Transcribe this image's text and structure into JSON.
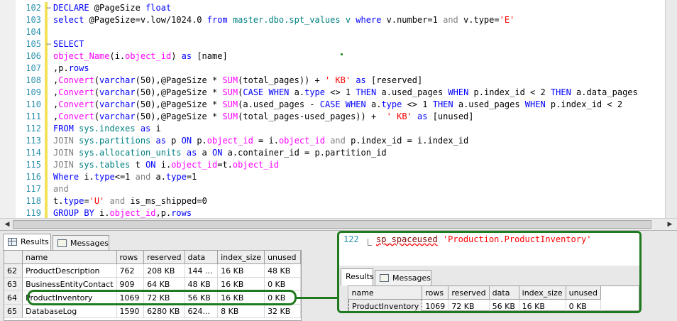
{
  "editor": {
    "lines": [
      {
        "num": "102",
        "tokens": [
          {
            "t": "DECLARE",
            "c": "kw"
          },
          {
            "t": " @PageSize ",
            "c": ""
          },
          {
            "t": "float",
            "c": "kw"
          }
        ]
      },
      {
        "num": "103",
        "tokens": [
          {
            "t": "select",
            "c": "kw"
          },
          {
            "t": " @PageSize=v.low/1024.0 ",
            "c": ""
          },
          {
            "t": "from",
            "c": "kw"
          },
          {
            "t": " master.dbo.spt_values v ",
            "c": "cm"
          },
          {
            "t": "where",
            "c": "kw"
          },
          {
            "t": " v.number=1 ",
            "c": ""
          },
          {
            "t": "and",
            "c": "op"
          },
          {
            "t": " v.type=",
            "c": ""
          },
          {
            "t": "'E'",
            "c": "st"
          }
        ]
      },
      {
        "num": "104",
        "tokens": []
      },
      {
        "num": "105",
        "tokens": [
          {
            "t": "SELECT",
            "c": "kw"
          }
        ]
      },
      {
        "num": "106",
        "tokens": [
          {
            "t": "object_Name",
            "c": "fn"
          },
          {
            "t": "(i.",
            "c": ""
          },
          {
            "t": "object_id",
            "c": "fn"
          },
          {
            "t": ") ",
            "c": ""
          },
          {
            "t": "as",
            "c": "kw"
          },
          {
            "t": " [name]",
            "c": ""
          }
        ]
      },
      {
        "num": "107",
        "tokens": [
          {
            "t": ",p.",
            "c": ""
          },
          {
            "t": "rows",
            "c": "kw"
          }
        ]
      },
      {
        "num": "108",
        "tokens": [
          {
            "t": ",",
            "c": ""
          },
          {
            "t": "Convert",
            "c": "fn"
          },
          {
            "t": "(",
            "c": ""
          },
          {
            "t": "varchar",
            "c": "kw"
          },
          {
            "t": "(50),@PageSize * ",
            "c": ""
          },
          {
            "t": "SUM",
            "c": "fn"
          },
          {
            "t": "(total_pages)) + ",
            "c": ""
          },
          {
            "t": "' KB'",
            "c": "st"
          },
          {
            "t": " ",
            "c": ""
          },
          {
            "t": "as",
            "c": "kw"
          },
          {
            "t": " [reserved]",
            "c": ""
          }
        ]
      },
      {
        "num": "109",
        "tokens": [
          {
            "t": ",",
            "c": ""
          },
          {
            "t": "Convert",
            "c": "fn"
          },
          {
            "t": "(",
            "c": ""
          },
          {
            "t": "varchar",
            "c": "kw"
          },
          {
            "t": "(50),@PageSize * ",
            "c": ""
          },
          {
            "t": "SUM",
            "c": "fn"
          },
          {
            "t": "(",
            "c": ""
          },
          {
            "t": "CASE WHEN",
            "c": "kw"
          },
          {
            "t": " a.",
            "c": ""
          },
          {
            "t": "type",
            "c": "kw"
          },
          {
            "t": " <> 1 ",
            "c": ""
          },
          {
            "t": "THEN",
            "c": "kw"
          },
          {
            "t": " a.used_pages ",
            "c": ""
          },
          {
            "t": "WHEN",
            "c": "kw"
          },
          {
            "t": " p.index_id < 2 ",
            "c": ""
          },
          {
            "t": "THEN",
            "c": "kw"
          },
          {
            "t": " a.data_pages",
            "c": ""
          }
        ]
      },
      {
        "num": "110",
        "tokens": [
          {
            "t": ",",
            "c": ""
          },
          {
            "t": "Convert",
            "c": "fn"
          },
          {
            "t": "(",
            "c": ""
          },
          {
            "t": "varchar",
            "c": "kw"
          },
          {
            "t": "(50),@PageSize * ",
            "c": ""
          },
          {
            "t": "SUM",
            "c": "fn"
          },
          {
            "t": "(a.used_pages - ",
            "c": ""
          },
          {
            "t": "CASE WHEN",
            "c": "kw"
          },
          {
            "t": " a.",
            "c": ""
          },
          {
            "t": "type",
            "c": "kw"
          },
          {
            "t": " <> 1 ",
            "c": ""
          },
          {
            "t": "THEN",
            "c": "kw"
          },
          {
            "t": " a.used_pages ",
            "c": ""
          },
          {
            "t": "WHEN",
            "c": "kw"
          },
          {
            "t": " p.index_id < 2",
            "c": ""
          }
        ]
      },
      {
        "num": "111",
        "tokens": [
          {
            "t": ",",
            "c": ""
          },
          {
            "t": "Convert",
            "c": "fn"
          },
          {
            "t": "(",
            "c": ""
          },
          {
            "t": "varchar",
            "c": "kw"
          },
          {
            "t": "(50),@PageSize * ",
            "c": ""
          },
          {
            "t": "SUM",
            "c": "fn"
          },
          {
            "t": "(total_pages-used_pages)) +  ",
            "c": ""
          },
          {
            "t": "' KB'",
            "c": "st"
          },
          {
            "t": " ",
            "c": ""
          },
          {
            "t": "as",
            "c": "kw"
          },
          {
            "t": " [unused]",
            "c": ""
          }
        ]
      },
      {
        "num": "112",
        "tokens": [
          {
            "t": "FROM",
            "c": "kw"
          },
          {
            "t": " sys.indexes ",
            "c": "cm"
          },
          {
            "t": "as",
            "c": "kw"
          },
          {
            "t": " i",
            "c": ""
          }
        ]
      },
      {
        "num": "113",
        "tokens": [
          {
            "t": "JOIN",
            "c": "op"
          },
          {
            "t": " sys.partitions ",
            "c": "cm"
          },
          {
            "t": "as",
            "c": "kw"
          },
          {
            "t": " p ",
            "c": ""
          },
          {
            "t": "ON",
            "c": "kw"
          },
          {
            "t": " p.",
            "c": ""
          },
          {
            "t": "object_id",
            "c": "fn"
          },
          {
            "t": " = i.",
            "c": ""
          },
          {
            "t": "object_id",
            "c": "fn"
          },
          {
            "t": " ",
            "c": ""
          },
          {
            "t": "and",
            "c": "op"
          },
          {
            "t": " p.index_id = i.index_id",
            "c": ""
          }
        ]
      },
      {
        "num": "114",
        "tokens": [
          {
            "t": "JOIN",
            "c": "op"
          },
          {
            "t": " sys.allocation_units ",
            "c": "cm"
          },
          {
            "t": "as",
            "c": "kw"
          },
          {
            "t": " a ",
            "c": ""
          },
          {
            "t": "ON",
            "c": "kw"
          },
          {
            "t": " a.container_id = p.partition_id",
            "c": ""
          }
        ]
      },
      {
        "num": "115",
        "tokens": [
          {
            "t": "JOIN",
            "c": "op"
          },
          {
            "t": " sys.tables ",
            "c": "cm"
          },
          {
            "t": "t ",
            "c": ""
          },
          {
            "t": "ON",
            "c": "kw"
          },
          {
            "t": " i.",
            "c": ""
          },
          {
            "t": "object_id",
            "c": "fn"
          },
          {
            "t": "=t.",
            "c": ""
          },
          {
            "t": "object_id",
            "c": "fn"
          }
        ]
      },
      {
        "num": "116",
        "tokens": [
          {
            "t": "Where",
            "c": "kw"
          },
          {
            "t": " i.",
            "c": ""
          },
          {
            "t": "type",
            "c": "kw"
          },
          {
            "t": "<=1 ",
            "c": ""
          },
          {
            "t": "and",
            "c": "op"
          },
          {
            "t": " a.",
            "c": ""
          },
          {
            "t": "type",
            "c": "kw"
          },
          {
            "t": "=1",
            "c": ""
          }
        ]
      },
      {
        "num": "117",
        "tokens": [
          {
            "t": "and",
            "c": "op"
          }
        ]
      },
      {
        "num": "118",
        "tokens": [
          {
            "t": "t.",
            "c": ""
          },
          {
            "t": "type",
            "c": "kw"
          },
          {
            "t": "=",
            "c": ""
          },
          {
            "t": "'U'",
            "c": "st"
          },
          {
            "t": " ",
            "c": ""
          },
          {
            "t": "and",
            "c": "op"
          },
          {
            "t": " is_ms_shipped=0",
            "c": ""
          }
        ]
      },
      {
        "num": "119",
        "tokens": [
          {
            "t": "GROUP BY",
            "c": "kw"
          },
          {
            "t": " i.",
            "c": ""
          },
          {
            "t": "object_id",
            "c": "fn"
          },
          {
            "t": ",p.",
            "c": ""
          },
          {
            "t": "rows",
            "c": "kw"
          }
        ]
      }
    ]
  },
  "scroll": {
    "left_arrow": "◀",
    "right_arrow": "▶"
  },
  "results": {
    "tabs": [
      {
        "label": "Results"
      },
      {
        "label": "Messages"
      }
    ],
    "columns": [
      "name",
      "rows",
      "reserved",
      "data",
      "index_size",
      "unused"
    ],
    "rows": [
      {
        "num": "62",
        "cells": [
          "ProductDescription",
          "762",
          "208 KB",
          "144 ...",
          "16 KB",
          "48 KB"
        ]
      },
      {
        "num": "63",
        "cells": [
          "BusinessEntityContact",
          "909",
          "64 KB",
          "48 KB",
          "16 KB",
          "0 KB"
        ]
      },
      {
        "num": "64",
        "cells": [
          "ProductInventory",
          "1069",
          "72 KB",
          "56 KB",
          "16 KB",
          "0 KB"
        ]
      },
      {
        "num": "65",
        "cells": [
          "DatabaseLog",
          "1590",
          "6280 KB",
          "624...",
          "8 KB",
          "32 KB"
        ]
      }
    ]
  },
  "overlay": {
    "line_num": "122",
    "stmt_proc": "sp_spaceused",
    "stmt_arg": "'Production.ProductInventory'",
    "tabs": [
      {
        "label": "Results"
      },
      {
        "label": "Messages"
      }
    ],
    "columns": [
      "name",
      "rows",
      "reserved",
      "data",
      "index_size",
      "unused"
    ],
    "row": [
      "ProductInventory",
      "1069",
      "72 KB",
      "56 KB",
      "16 KB",
      "0 KB"
    ]
  },
  "colors": {
    "highlight": "#1f7a1f",
    "keyword": "#0000ff",
    "string": "#ff0000",
    "function": "#ff00ff",
    "line_number": "#2b91af"
  }
}
